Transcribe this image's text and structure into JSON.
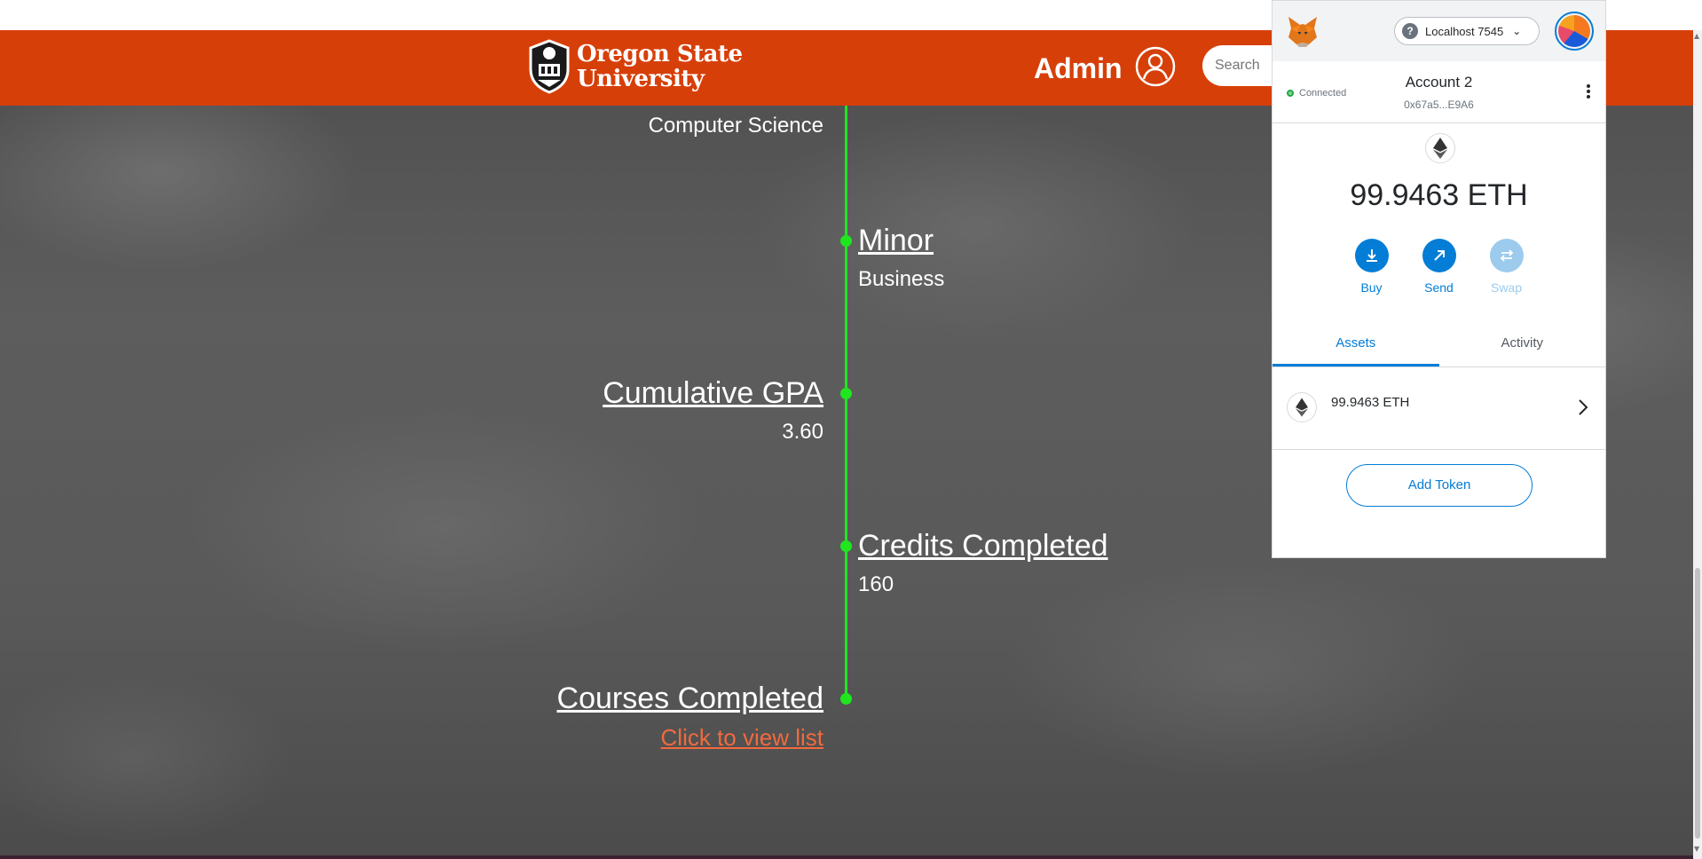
{
  "navbar": {
    "logo_line1": "Oregon State",
    "logo_line2": "University",
    "admin_label": "Admin",
    "search_placeholder": "Search"
  },
  "timeline": {
    "major_value": "Computer Science",
    "minor_title": "Minor",
    "minor_value": "Business",
    "gpa_title": "Cumulative GPA",
    "gpa_value": "3.60",
    "credits_title": "Credits Completed",
    "credits_value": "160",
    "courses_title": "Courses Completed",
    "courses_link": "Click to view list"
  },
  "metamask": {
    "network": "Localhost 7545",
    "status": "Connected",
    "account_name": "Account 2",
    "account_address": "0x67a5...E9A6",
    "balance": "99.9463 ETH",
    "actions": [
      {
        "label": "Buy",
        "enabled": true
      },
      {
        "label": "Send",
        "enabled": true
      },
      {
        "label": "Swap",
        "enabled": false
      }
    ],
    "tabs": [
      {
        "label": "Assets",
        "active": true
      },
      {
        "label": "Activity",
        "active": false
      }
    ],
    "asset_label": "99.9463 ETH",
    "add_token_label": "Add Token"
  },
  "colors": {
    "brand_orange": "#d73f09",
    "timeline_green": "#1fe61f",
    "link_orange": "#f26a3d",
    "metamask_blue": "#037dd6"
  }
}
